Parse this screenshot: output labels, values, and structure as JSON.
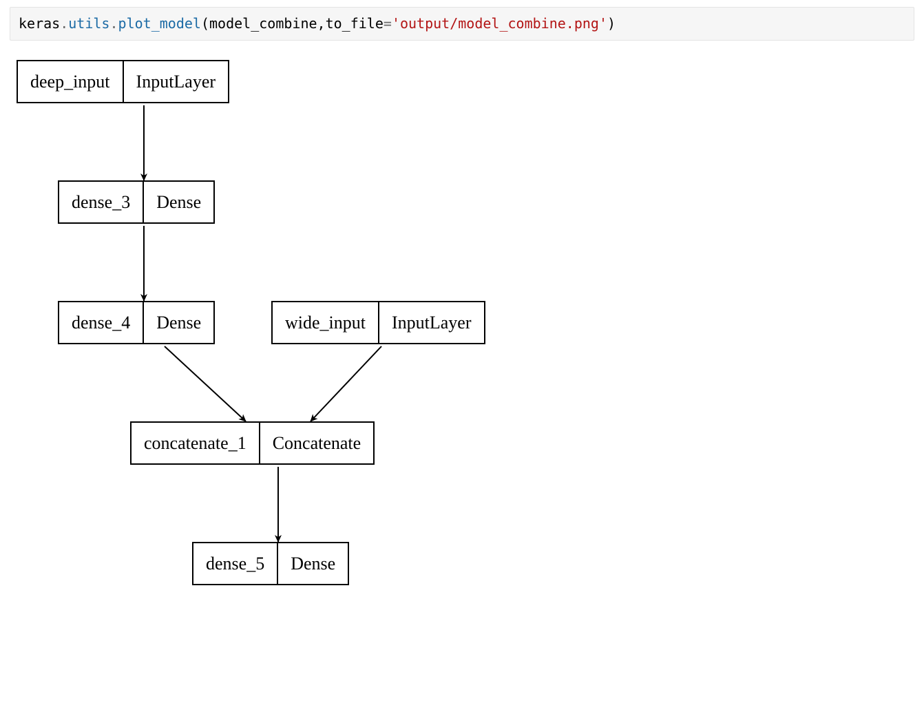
{
  "code": {
    "prefix": "keras",
    "dot1": ".",
    "mod": "utils",
    "dot2": ".",
    "func": "plot_model",
    "lpar": "(",
    "arg1": "model_combine",
    "comma": ",",
    "kwarg": "to_file",
    "eq": "=",
    "str": "'output/model_combine.png'",
    "rpar": ")"
  },
  "layers": {
    "deep_input": {
      "name": "deep_input",
      "type": "InputLayer"
    },
    "dense_3": {
      "name": "dense_3",
      "type": "Dense"
    },
    "dense_4": {
      "name": "dense_4",
      "type": "Dense"
    },
    "wide_input": {
      "name": "wide_input",
      "type": "InputLayer"
    },
    "concat_1": {
      "name": "concatenate_1",
      "type": "Concatenate"
    },
    "dense_5": {
      "name": "dense_5",
      "type": "Dense"
    }
  },
  "edges": [
    {
      "from": "deep_input",
      "to": "dense_3"
    },
    {
      "from": "dense_3",
      "to": "dense_4"
    },
    {
      "from": "dense_4",
      "to": "concat_1"
    },
    {
      "from": "wide_input",
      "to": "concat_1"
    },
    {
      "from": "concat_1",
      "to": "dense_5"
    }
  ]
}
